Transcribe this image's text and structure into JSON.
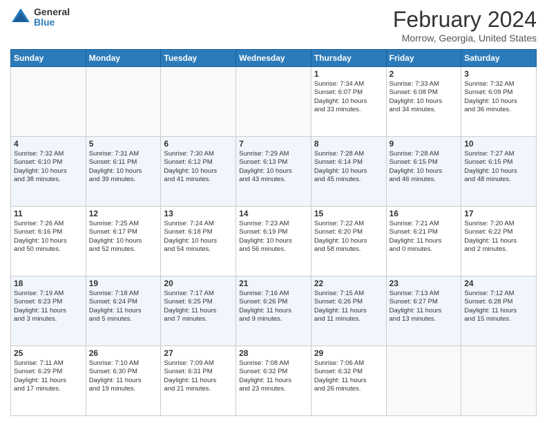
{
  "logo": {
    "general": "General",
    "blue": "Blue"
  },
  "header": {
    "month": "February 2024",
    "location": "Morrow, Georgia, United States"
  },
  "days_header": [
    "Sunday",
    "Monday",
    "Tuesday",
    "Wednesday",
    "Thursday",
    "Friday",
    "Saturday"
  ],
  "weeks": [
    [
      {
        "day": "",
        "info": ""
      },
      {
        "day": "",
        "info": ""
      },
      {
        "day": "",
        "info": ""
      },
      {
        "day": "",
        "info": ""
      },
      {
        "day": "1",
        "info": "Sunrise: 7:34 AM\nSunset: 6:07 PM\nDaylight: 10 hours\nand 33 minutes."
      },
      {
        "day": "2",
        "info": "Sunrise: 7:33 AM\nSunset: 6:08 PM\nDaylight: 10 hours\nand 34 minutes."
      },
      {
        "day": "3",
        "info": "Sunrise: 7:32 AM\nSunset: 6:09 PM\nDaylight: 10 hours\nand 36 minutes."
      }
    ],
    [
      {
        "day": "4",
        "info": "Sunrise: 7:32 AM\nSunset: 6:10 PM\nDaylight: 10 hours\nand 38 minutes."
      },
      {
        "day": "5",
        "info": "Sunrise: 7:31 AM\nSunset: 6:11 PM\nDaylight: 10 hours\nand 39 minutes."
      },
      {
        "day": "6",
        "info": "Sunrise: 7:30 AM\nSunset: 6:12 PM\nDaylight: 10 hours\nand 41 minutes."
      },
      {
        "day": "7",
        "info": "Sunrise: 7:29 AM\nSunset: 6:13 PM\nDaylight: 10 hours\nand 43 minutes."
      },
      {
        "day": "8",
        "info": "Sunrise: 7:28 AM\nSunset: 6:14 PM\nDaylight: 10 hours\nand 45 minutes."
      },
      {
        "day": "9",
        "info": "Sunrise: 7:28 AM\nSunset: 6:15 PM\nDaylight: 10 hours\nand 46 minutes."
      },
      {
        "day": "10",
        "info": "Sunrise: 7:27 AM\nSunset: 6:15 PM\nDaylight: 10 hours\nand 48 minutes."
      }
    ],
    [
      {
        "day": "11",
        "info": "Sunrise: 7:26 AM\nSunset: 6:16 PM\nDaylight: 10 hours\nand 50 minutes."
      },
      {
        "day": "12",
        "info": "Sunrise: 7:25 AM\nSunset: 6:17 PM\nDaylight: 10 hours\nand 52 minutes."
      },
      {
        "day": "13",
        "info": "Sunrise: 7:24 AM\nSunset: 6:18 PM\nDaylight: 10 hours\nand 54 minutes."
      },
      {
        "day": "14",
        "info": "Sunrise: 7:23 AM\nSunset: 6:19 PM\nDaylight: 10 hours\nand 56 minutes."
      },
      {
        "day": "15",
        "info": "Sunrise: 7:22 AM\nSunset: 6:20 PM\nDaylight: 10 hours\nand 58 minutes."
      },
      {
        "day": "16",
        "info": "Sunrise: 7:21 AM\nSunset: 6:21 PM\nDaylight: 11 hours\nand 0 minutes."
      },
      {
        "day": "17",
        "info": "Sunrise: 7:20 AM\nSunset: 6:22 PM\nDaylight: 11 hours\nand 2 minutes."
      }
    ],
    [
      {
        "day": "18",
        "info": "Sunrise: 7:19 AM\nSunset: 6:23 PM\nDaylight: 11 hours\nand 3 minutes."
      },
      {
        "day": "19",
        "info": "Sunrise: 7:18 AM\nSunset: 6:24 PM\nDaylight: 11 hours\nand 5 minutes."
      },
      {
        "day": "20",
        "info": "Sunrise: 7:17 AM\nSunset: 6:25 PM\nDaylight: 11 hours\nand 7 minutes."
      },
      {
        "day": "21",
        "info": "Sunrise: 7:16 AM\nSunset: 6:26 PM\nDaylight: 11 hours\nand 9 minutes."
      },
      {
        "day": "22",
        "info": "Sunrise: 7:15 AM\nSunset: 6:26 PM\nDaylight: 11 hours\nand 11 minutes."
      },
      {
        "day": "23",
        "info": "Sunrise: 7:13 AM\nSunset: 6:27 PM\nDaylight: 11 hours\nand 13 minutes."
      },
      {
        "day": "24",
        "info": "Sunrise: 7:12 AM\nSunset: 6:28 PM\nDaylight: 11 hours\nand 15 minutes."
      }
    ],
    [
      {
        "day": "25",
        "info": "Sunrise: 7:11 AM\nSunset: 6:29 PM\nDaylight: 11 hours\nand 17 minutes."
      },
      {
        "day": "26",
        "info": "Sunrise: 7:10 AM\nSunset: 6:30 PM\nDaylight: 11 hours\nand 19 minutes."
      },
      {
        "day": "27",
        "info": "Sunrise: 7:09 AM\nSunset: 6:31 PM\nDaylight: 11 hours\nand 21 minutes."
      },
      {
        "day": "28",
        "info": "Sunrise: 7:08 AM\nSunset: 6:32 PM\nDaylight: 11 hours\nand 23 minutes."
      },
      {
        "day": "29",
        "info": "Sunrise: 7:06 AM\nSunset: 6:32 PM\nDaylight: 11 hours\nand 26 minutes."
      },
      {
        "day": "",
        "info": ""
      },
      {
        "day": "",
        "info": ""
      }
    ]
  ]
}
